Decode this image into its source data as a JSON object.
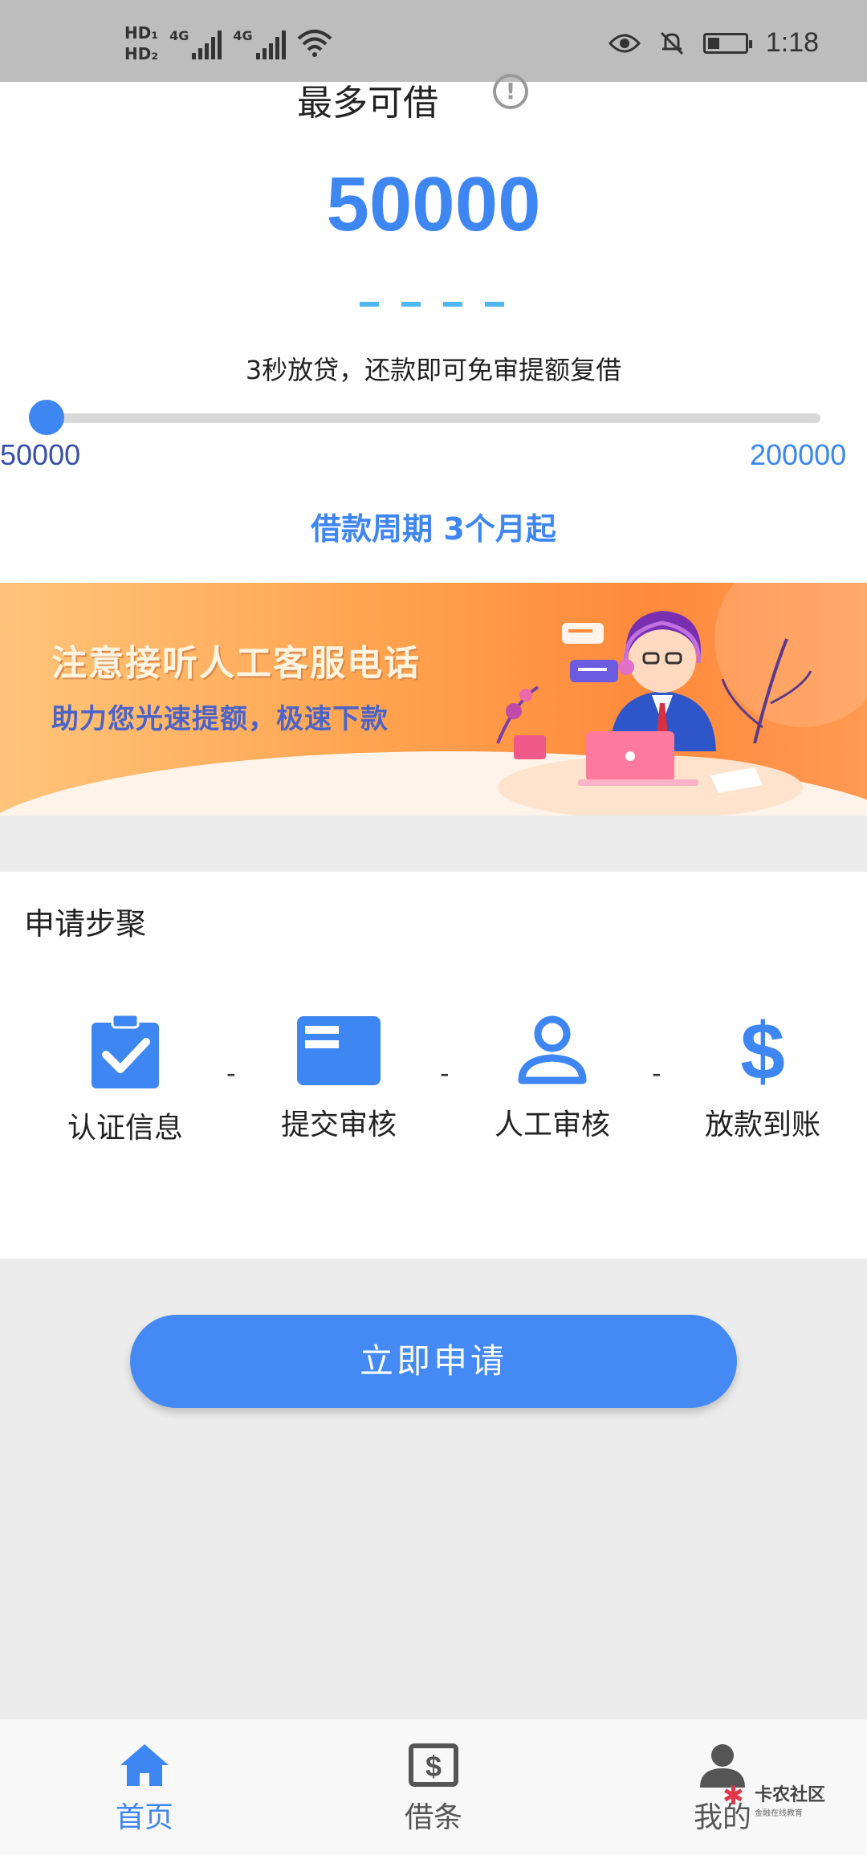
{
  "status_bar": {
    "hd1": "HD₁",
    "hd2": "HD₂",
    "net1": "4G",
    "net2": "4G",
    "time": "1:18"
  },
  "loan": {
    "max_title": "最多可借",
    "amount": "50000",
    "subline": "3秒放贷，还款即可免审提额复借",
    "slider_min": "50000",
    "slider_max": "200000",
    "slider_value": 0,
    "period": "借款周期 3个月起"
  },
  "banner": {
    "title": "注意接听人工客服电话",
    "subtitle": "助力您光速提额，极速下款"
  },
  "steps": {
    "title": "申请步聚",
    "items": [
      {
        "label": "认证信息",
        "icon": "clipboard-check-icon"
      },
      {
        "label": "提交审核",
        "icon": "card-icon"
      },
      {
        "label": "人工审核",
        "icon": "person-icon"
      },
      {
        "label": "放款到账",
        "icon": "dollar-icon"
      }
    ],
    "separator": "-"
  },
  "apply_button": "立即申请",
  "nav": {
    "items": [
      {
        "label": "首页",
        "icon": "home-icon",
        "active": true
      },
      {
        "label": "借条",
        "icon": "dollar-bill-icon",
        "active": false
      },
      {
        "label": "我的",
        "icon": "user-icon",
        "active": false
      }
    ]
  },
  "watermark": {
    "text": "卡农社区",
    "sub": "金融在线教育"
  },
  "colors": {
    "primary": "#3e86f2",
    "status_bar": "#bdbdbd",
    "background": "#ececec",
    "banner_orange": "#ff8a3c"
  }
}
